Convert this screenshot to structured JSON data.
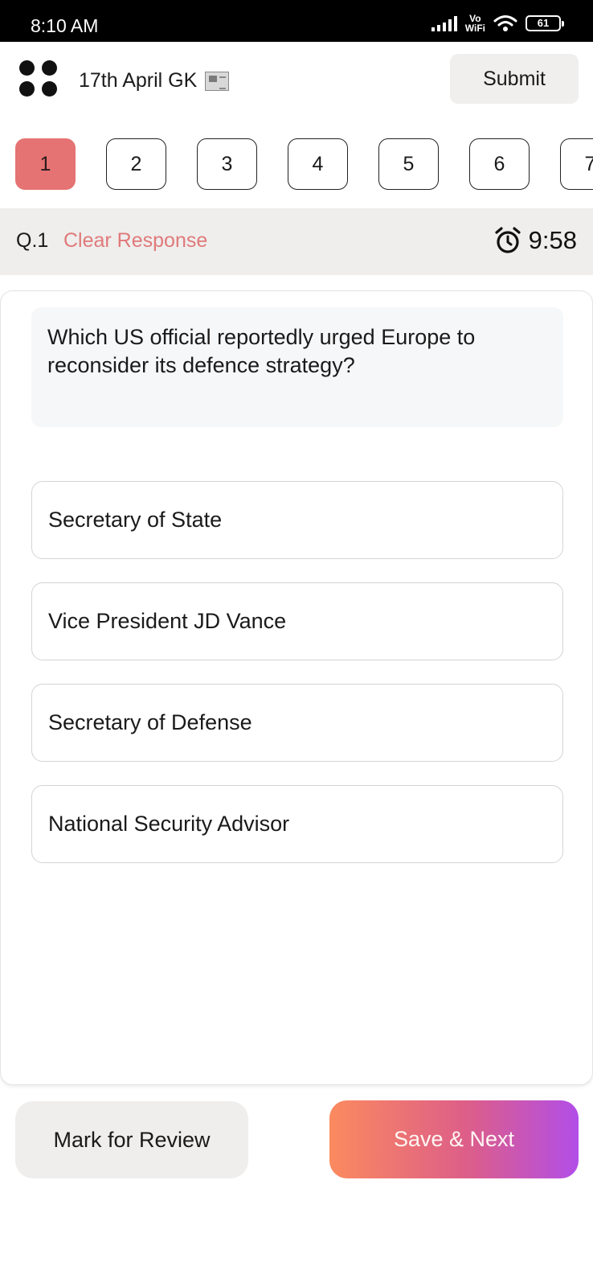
{
  "status_bar": {
    "time": "8:10 AM",
    "network_label_top": "Vo",
    "network_label_bottom": "WiFi",
    "battery": "61"
  },
  "header": {
    "title": "17th April GK",
    "title_icon": "newspaper-icon",
    "menu_icon": "four-dots-icon",
    "submit_label": "Submit"
  },
  "question_nav": {
    "numbers": [
      "1",
      "2",
      "3",
      "4",
      "5",
      "6",
      "7"
    ],
    "active": "1",
    "active_color": "#e57373"
  },
  "info_bar": {
    "question_label": "Q.1",
    "clear_label": "Clear Response",
    "clear_color": "#e0797a",
    "timer_icon": "alarm-clock-icon",
    "timer": "9:58"
  },
  "question": {
    "text": "Which US official reportedly urged Europe to reconsider its defence strategy?",
    "options": [
      "Secretary of State",
      "Vice President JD Vance",
      "Secretary of Defense",
      "National Security Advisor"
    ]
  },
  "footer": {
    "review_label": "Mark for Review",
    "next_label": "Save & Next",
    "next_gradient": [
      "#fb8a5f",
      "#dd5e88",
      "#b24ee8"
    ]
  }
}
